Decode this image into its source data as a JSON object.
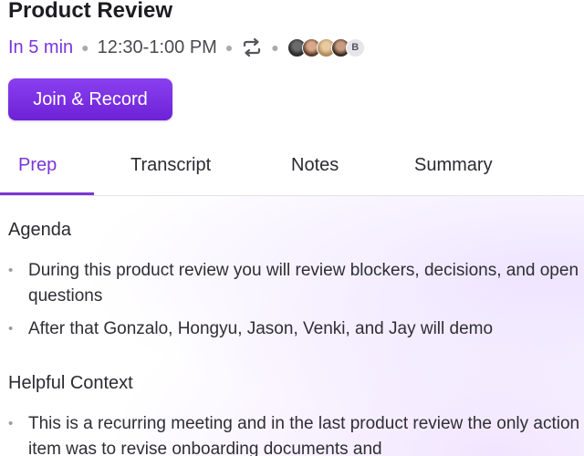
{
  "meeting": {
    "title": "Product Review",
    "starts_in": "In 5 min",
    "time_range": "12:30-1:00 PM",
    "recurring_icon": "repeat-icon",
    "attendee_extra_initial": "B",
    "join_label": "Join & Record"
  },
  "tabs": [
    {
      "label": "Prep",
      "active": true
    },
    {
      "label": "Transcript",
      "active": false
    },
    {
      "label": "Notes",
      "active": false
    },
    {
      "label": "Summary",
      "active": false
    }
  ],
  "prep": {
    "agenda_heading": "Agenda",
    "agenda_items": [
      "During this product review you will review blockers, decisions, and open questions",
      "After that Gonzalo, Hongyu, Jason, Venki, and Jay will demo"
    ],
    "context_heading": "Helpful Context",
    "context_items": [
      "This is a recurring meeting and in the last product review the only action item was to revise onboarding documents and"
    ]
  },
  "colors": {
    "accent": "#7a35d9",
    "button_gradient_top": "#8a3ff0",
    "button_gradient_bottom": "#6d22d6"
  }
}
